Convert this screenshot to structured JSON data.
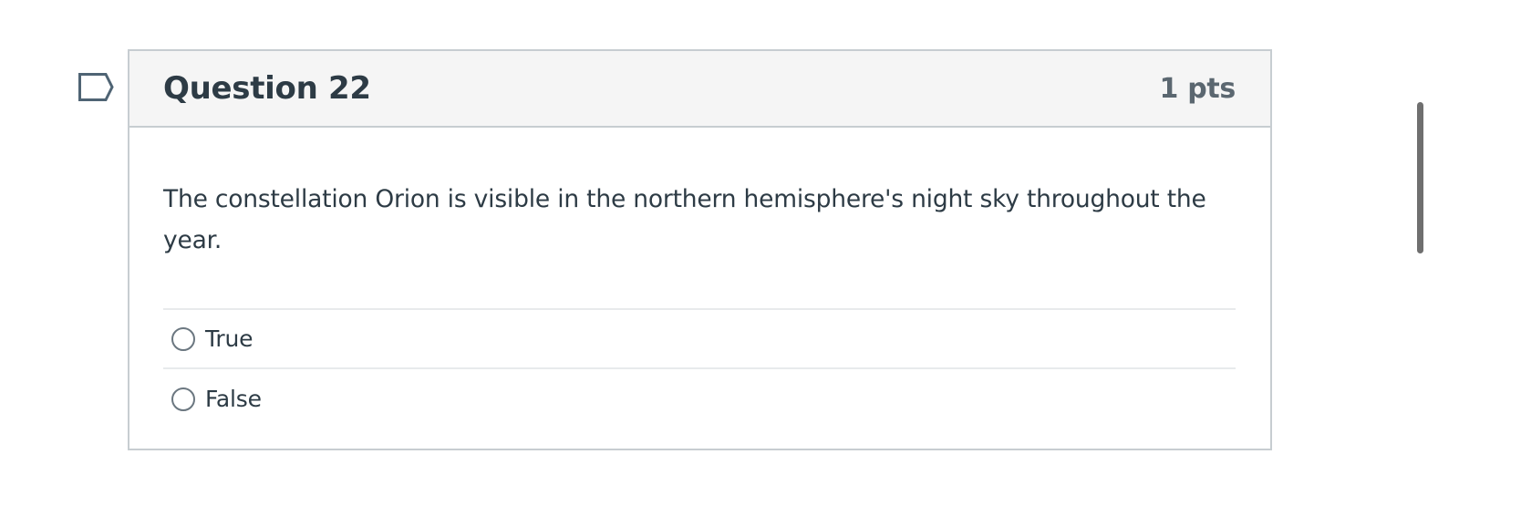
{
  "question": {
    "title": "Question 22",
    "points": "1 pts",
    "text": "The constellation Orion is visible in the northern hemisphere's night sky throughout the year.",
    "answers": [
      {
        "label": "True",
        "selected": false
      },
      {
        "label": "False",
        "selected": false
      }
    ]
  },
  "flag": {
    "icon": "bookmark-flag-icon",
    "flagged": false
  },
  "colors": {
    "text": "#2d3b45",
    "points": "#5b6770",
    "header_bg": "#f5f5f5",
    "border": "#c7cdd1"
  }
}
